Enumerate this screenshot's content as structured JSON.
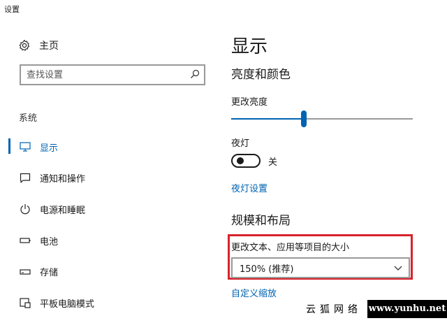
{
  "window": {
    "title": "设置"
  },
  "sidebar": {
    "home_label": "主页",
    "search_placeholder": "查找设置",
    "section_label": "系统",
    "items": [
      {
        "label": "显示",
        "icon": "monitor-icon",
        "active": true
      },
      {
        "label": "通知和操作",
        "icon": "notification-icon",
        "active": false
      },
      {
        "label": "电源和睡眠",
        "icon": "power-icon",
        "active": false
      },
      {
        "label": "电池",
        "icon": "battery-icon",
        "active": false
      },
      {
        "label": "存储",
        "icon": "storage-icon",
        "active": false
      },
      {
        "label": "平板电脑模式",
        "icon": "tablet-mode-icon",
        "active": false
      }
    ]
  },
  "main": {
    "title": "显示",
    "brightness_color_heading": "亮度和颜色",
    "brightness_label": "更改亮度",
    "brightness_value": 0.4,
    "night_light_label": "夜灯",
    "night_light_state": "关",
    "night_light_settings_link": "夜灯设置",
    "scale_layout_heading": "规模和布局",
    "scale_label": "更改文本、应用等项目的大小",
    "scale_value": "150% (推荐)",
    "custom_scaling_link": "自定义缩放"
  },
  "colors": {
    "accent": "#0063b1",
    "highlight": "#d8222b"
  },
  "watermark": {
    "cn": "云狐网络",
    "url": "www.yunhu.net"
  }
}
